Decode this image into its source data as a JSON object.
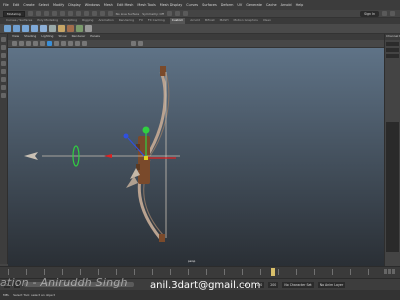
{
  "menubar": {
    "items": [
      "File",
      "Edit",
      "Create",
      "Select",
      "Modify",
      "Display",
      "Windows",
      "Mesh",
      "Edit Mesh",
      "Mesh Tools",
      "Mesh Display",
      "Curves",
      "Surfaces",
      "Deform",
      "UV",
      "Generate",
      "Cache",
      "Arnold",
      "Help"
    ]
  },
  "status": {
    "mode": "Modeling",
    "no_live": "No Live Surface",
    "sym": "Symmetry: Off",
    "sign_in": "Sign In"
  },
  "shelf_tabs": [
    "Curves / Surfaces",
    "Poly Modeling",
    "Sculpting",
    "Rigging",
    "Animation",
    "Rendering",
    "FX",
    "FX Caching",
    "Custom",
    "Arnold",
    "Bifrost",
    "MASH",
    "Motion Graphics",
    "XGen"
  ],
  "active_shelf_tab": "Custom",
  "viewport": {
    "menu": [
      "View",
      "Shading",
      "Lighting",
      "Show",
      "Renderer",
      "Panels"
    ],
    "camera_label": "persp"
  },
  "right_panel": {
    "tab": "Channel Box / Layer Editor"
  },
  "range": {
    "start": "1",
    "start_inner": "1",
    "end_inner": "120",
    "end": "120",
    "end2": "200",
    "char_set": "No Character Set",
    "anim_layer": "No Anim Layer"
  },
  "command_line": {
    "mel": "MEL",
    "help": "Select Tool: select an object"
  },
  "overlay": {
    "watermark": "ation - Aniruddh Singh",
    "email": "anil.3dart@gmail.com"
  },
  "colors": {
    "accent": "#3a8fd8",
    "bow": "#b9a290",
    "grip": "#7a4a2b",
    "gizmo_red": "#e02020",
    "gizmo_green": "#30d040",
    "gizmo_blue": "#3050e0",
    "gizmo_yellow": "#e0d020"
  }
}
